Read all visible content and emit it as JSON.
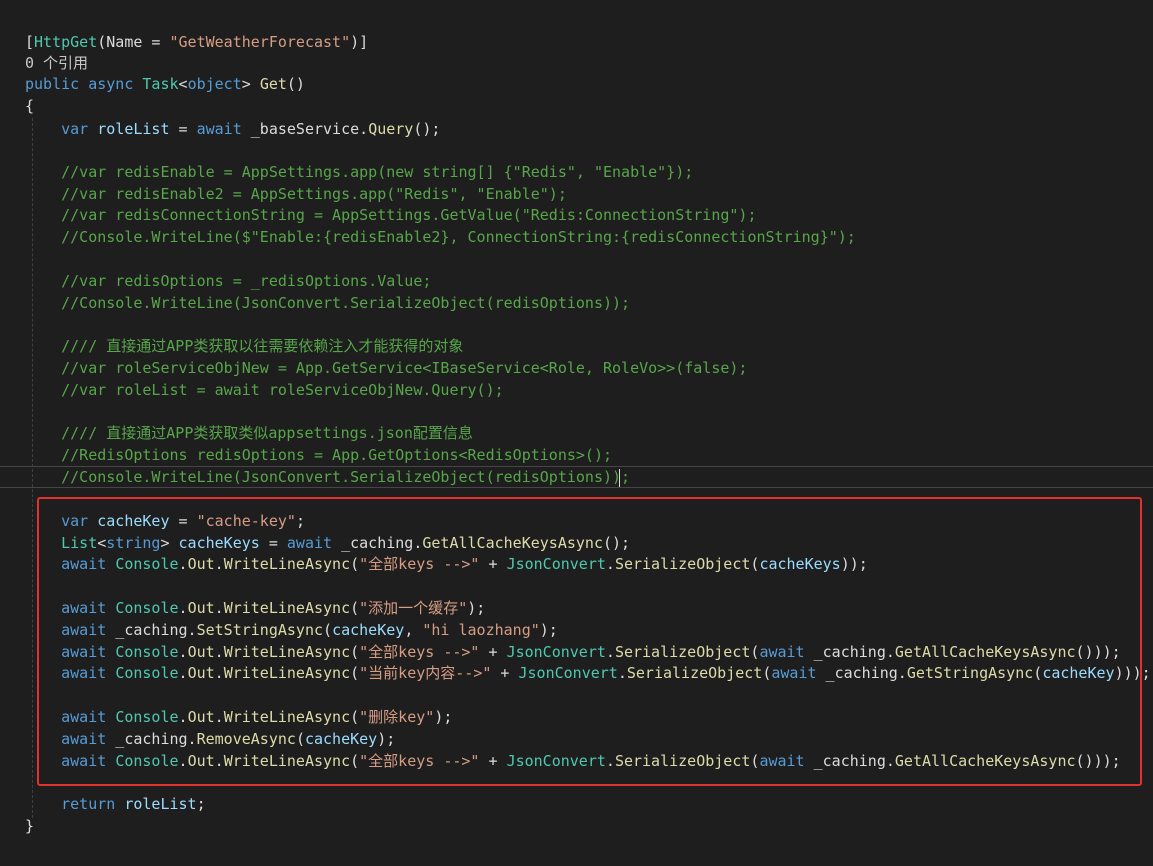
{
  "editor": {
    "colors": {
      "background": "#1e1e1e",
      "keyword": "#569cd6",
      "type": "#4ec9b0",
      "method": "#dcdcaa",
      "string": "#d69d85",
      "comment": "#57a64a",
      "variable": "#9cdcfe",
      "highlight_border": "#e0332e"
    },
    "lines": [
      {
        "tokens": [
          {
            "t": "p",
            "v": "["
          },
          {
            "t": "t",
            "v": "HttpGet"
          },
          {
            "t": "p",
            "v": "(Name = "
          },
          {
            "t": "s",
            "v": "\"GetWeatherForecast\""
          },
          {
            "t": "p",
            "v": ")]"
          }
        ]
      },
      {
        "tokens": [
          {
            "t": "g",
            "v": "0 个引用"
          }
        ]
      },
      {
        "tokens": [
          {
            "t": "k",
            "v": "public"
          },
          {
            "t": "p",
            "v": " "
          },
          {
            "t": "k",
            "v": "async"
          },
          {
            "t": "p",
            "v": " "
          },
          {
            "t": "t",
            "v": "Task"
          },
          {
            "t": "p",
            "v": "<"
          },
          {
            "t": "k",
            "v": "object"
          },
          {
            "t": "p",
            "v": "> "
          },
          {
            "t": "m",
            "v": "Get"
          },
          {
            "t": "p",
            "v": "()"
          }
        ]
      },
      {
        "tokens": [
          {
            "t": "p",
            "v": "{"
          }
        ]
      },
      {
        "tokens": [
          {
            "t": "p",
            "v": "    "
          },
          {
            "t": "k",
            "v": "var"
          },
          {
            "t": "p",
            "v": " "
          },
          {
            "t": "v",
            "v": "roleList"
          },
          {
            "t": "p",
            "v": " = "
          },
          {
            "t": "k",
            "v": "await"
          },
          {
            "t": "p",
            "v": " _baseService."
          },
          {
            "t": "m",
            "v": "Query"
          },
          {
            "t": "p",
            "v": "();"
          }
        ]
      },
      {
        "tokens": []
      },
      {
        "tokens": [
          {
            "t": "p",
            "v": "    "
          },
          {
            "t": "c",
            "v": "//var redisEnable = AppSettings.app(new string[] {\"Redis\", \"Enable\"});"
          }
        ]
      },
      {
        "tokens": [
          {
            "t": "p",
            "v": "    "
          },
          {
            "t": "c",
            "v": "//var redisEnable2 = AppSettings.app(\"Redis\", \"Enable\");"
          }
        ]
      },
      {
        "tokens": [
          {
            "t": "p",
            "v": "    "
          },
          {
            "t": "c",
            "v": "//var redisConnectionString = AppSettings.GetValue(\"Redis:ConnectionString\");"
          }
        ]
      },
      {
        "tokens": [
          {
            "t": "p",
            "v": "    "
          },
          {
            "t": "c",
            "v": "//Console.WriteLine($\"Enable:{redisEnable2}, ConnectionString:{redisConnectionString}\");"
          }
        ]
      },
      {
        "tokens": []
      },
      {
        "tokens": [
          {
            "t": "p",
            "v": "    "
          },
          {
            "t": "c",
            "v": "//var redisOptions = _redisOptions.Value;"
          }
        ]
      },
      {
        "tokens": [
          {
            "t": "p",
            "v": "    "
          },
          {
            "t": "c",
            "v": "//Console.WriteLine(JsonConvert.SerializeObject(redisOptions));"
          }
        ]
      },
      {
        "tokens": []
      },
      {
        "tokens": [
          {
            "t": "p",
            "v": "    "
          },
          {
            "t": "c",
            "v": "//// 直接通过APP类获取以往需要依赖注入才能获得的对象"
          }
        ]
      },
      {
        "tokens": [
          {
            "t": "p",
            "v": "    "
          },
          {
            "t": "c",
            "v": "//var roleServiceObjNew = App.GetService<IBaseService<Role, RoleVo>>(false);"
          }
        ]
      },
      {
        "tokens": [
          {
            "t": "p",
            "v": "    "
          },
          {
            "t": "c",
            "v": "//var roleList = await roleServiceObjNew.Query();"
          }
        ]
      },
      {
        "tokens": []
      },
      {
        "tokens": [
          {
            "t": "p",
            "v": "    "
          },
          {
            "t": "c",
            "v": "//// 直接通过APP类获取类似appsettings.json配置信息"
          }
        ]
      },
      {
        "tokens": [
          {
            "t": "p",
            "v": "    "
          },
          {
            "t": "c",
            "v": "//RedisOptions redisOptions = App.GetOptions<RedisOptions>();"
          }
        ]
      },
      {
        "tokens": [
          {
            "t": "p",
            "v": "    "
          },
          {
            "t": "c",
            "v": "//Console.WriteLine(JsonConvert.SerializeObject(redisOptions));"
          }
        ]
      },
      {
        "tokens": []
      },
      {
        "tokens": [
          {
            "t": "p",
            "v": "    "
          },
          {
            "t": "k",
            "v": "var"
          },
          {
            "t": "p",
            "v": " "
          },
          {
            "t": "v",
            "v": "cacheKey"
          },
          {
            "t": "p",
            "v": " = "
          },
          {
            "t": "s",
            "v": "\"cache-key\""
          },
          {
            "t": "p",
            "v": ";"
          }
        ]
      },
      {
        "tokens": [
          {
            "t": "p",
            "v": "    "
          },
          {
            "t": "t",
            "v": "List"
          },
          {
            "t": "p",
            "v": "<"
          },
          {
            "t": "k",
            "v": "string"
          },
          {
            "t": "p",
            "v": "> "
          },
          {
            "t": "v",
            "v": "cacheKeys"
          },
          {
            "t": "p",
            "v": " = "
          },
          {
            "t": "k",
            "v": "await"
          },
          {
            "t": "p",
            "v": " _caching."
          },
          {
            "t": "m",
            "v": "GetAllCacheKeysAsync"
          },
          {
            "t": "p",
            "v": "();"
          }
        ]
      },
      {
        "tokens": [
          {
            "t": "p",
            "v": "    "
          },
          {
            "t": "k",
            "v": "await"
          },
          {
            "t": "p",
            "v": " "
          },
          {
            "t": "t",
            "v": "Console"
          },
          {
            "t": "p",
            "v": "."
          },
          {
            "t": "m",
            "v": "Out"
          },
          {
            "t": "p",
            "v": "."
          },
          {
            "t": "m",
            "v": "WriteLineAsync"
          },
          {
            "t": "p",
            "v": "("
          },
          {
            "t": "s",
            "v": "\"全部keys -->\""
          },
          {
            "t": "p",
            "v": " + "
          },
          {
            "t": "t",
            "v": "JsonConvert"
          },
          {
            "t": "p",
            "v": "."
          },
          {
            "t": "m",
            "v": "SerializeObject"
          },
          {
            "t": "p",
            "v": "("
          },
          {
            "t": "v",
            "v": "cacheKeys"
          },
          {
            "t": "p",
            "v": "));"
          }
        ]
      },
      {
        "tokens": []
      },
      {
        "tokens": [
          {
            "t": "p",
            "v": "    "
          },
          {
            "t": "k",
            "v": "await"
          },
          {
            "t": "p",
            "v": " "
          },
          {
            "t": "t",
            "v": "Console"
          },
          {
            "t": "p",
            "v": "."
          },
          {
            "t": "m",
            "v": "Out"
          },
          {
            "t": "p",
            "v": "."
          },
          {
            "t": "m",
            "v": "WriteLineAsync"
          },
          {
            "t": "p",
            "v": "("
          },
          {
            "t": "s",
            "v": "\"添加一个缓存\""
          },
          {
            "t": "p",
            "v": ");"
          }
        ]
      },
      {
        "tokens": [
          {
            "t": "p",
            "v": "    "
          },
          {
            "t": "k",
            "v": "await"
          },
          {
            "t": "p",
            "v": " _caching."
          },
          {
            "t": "m",
            "v": "SetStringAsync"
          },
          {
            "t": "p",
            "v": "("
          },
          {
            "t": "v",
            "v": "cacheKey"
          },
          {
            "t": "p",
            "v": ", "
          },
          {
            "t": "s",
            "v": "\"hi laozhang\""
          },
          {
            "t": "p",
            "v": ");"
          }
        ]
      },
      {
        "tokens": [
          {
            "t": "p",
            "v": "    "
          },
          {
            "t": "k",
            "v": "await"
          },
          {
            "t": "p",
            "v": " "
          },
          {
            "t": "t",
            "v": "Console"
          },
          {
            "t": "p",
            "v": "."
          },
          {
            "t": "m",
            "v": "Out"
          },
          {
            "t": "p",
            "v": "."
          },
          {
            "t": "m",
            "v": "WriteLineAsync"
          },
          {
            "t": "p",
            "v": "("
          },
          {
            "t": "s",
            "v": "\"全部keys -->\""
          },
          {
            "t": "p",
            "v": " + "
          },
          {
            "t": "t",
            "v": "JsonConvert"
          },
          {
            "t": "p",
            "v": "."
          },
          {
            "t": "m",
            "v": "SerializeObject"
          },
          {
            "t": "p",
            "v": "("
          },
          {
            "t": "k",
            "v": "await"
          },
          {
            "t": "p",
            "v": " _caching."
          },
          {
            "t": "m",
            "v": "GetAllCacheKeysAsync"
          },
          {
            "t": "p",
            "v": "()));"
          }
        ]
      },
      {
        "tokens": [
          {
            "t": "p",
            "v": "    "
          },
          {
            "t": "k",
            "v": "await"
          },
          {
            "t": "p",
            "v": " "
          },
          {
            "t": "t",
            "v": "Console"
          },
          {
            "t": "p",
            "v": "."
          },
          {
            "t": "m",
            "v": "Out"
          },
          {
            "t": "p",
            "v": "."
          },
          {
            "t": "m",
            "v": "WriteLineAsync"
          },
          {
            "t": "p",
            "v": "("
          },
          {
            "t": "s",
            "v": "\"当前key内容-->\""
          },
          {
            "t": "p",
            "v": " + "
          },
          {
            "t": "t",
            "v": "JsonConvert"
          },
          {
            "t": "p",
            "v": "."
          },
          {
            "t": "m",
            "v": "SerializeObject"
          },
          {
            "t": "p",
            "v": "("
          },
          {
            "t": "k",
            "v": "await"
          },
          {
            "t": "p",
            "v": " _caching."
          },
          {
            "t": "m",
            "v": "GetStringAsync"
          },
          {
            "t": "p",
            "v": "("
          },
          {
            "t": "v",
            "v": "cacheKey"
          },
          {
            "t": "p",
            "v": ")));"
          }
        ]
      },
      {
        "tokens": []
      },
      {
        "tokens": [
          {
            "t": "p",
            "v": "    "
          },
          {
            "t": "k",
            "v": "await"
          },
          {
            "t": "p",
            "v": " "
          },
          {
            "t": "t",
            "v": "Console"
          },
          {
            "t": "p",
            "v": "."
          },
          {
            "t": "m",
            "v": "Out"
          },
          {
            "t": "p",
            "v": "."
          },
          {
            "t": "m",
            "v": "WriteLineAsync"
          },
          {
            "t": "p",
            "v": "("
          },
          {
            "t": "s",
            "v": "\"删除key\""
          },
          {
            "t": "p",
            "v": ");"
          }
        ]
      },
      {
        "tokens": [
          {
            "t": "p",
            "v": "    "
          },
          {
            "t": "k",
            "v": "await"
          },
          {
            "t": "p",
            "v": " _caching."
          },
          {
            "t": "m",
            "v": "RemoveAsync"
          },
          {
            "t": "p",
            "v": "("
          },
          {
            "t": "v",
            "v": "cacheKey"
          },
          {
            "t": "p",
            "v": ");"
          }
        ]
      },
      {
        "tokens": [
          {
            "t": "p",
            "v": "    "
          },
          {
            "t": "k",
            "v": "await"
          },
          {
            "t": "p",
            "v": " "
          },
          {
            "t": "t",
            "v": "Console"
          },
          {
            "t": "p",
            "v": "."
          },
          {
            "t": "m",
            "v": "Out"
          },
          {
            "t": "p",
            "v": "."
          },
          {
            "t": "m",
            "v": "WriteLineAsync"
          },
          {
            "t": "p",
            "v": "("
          },
          {
            "t": "s",
            "v": "\"全部keys -->\""
          },
          {
            "t": "p",
            "v": " + "
          },
          {
            "t": "t",
            "v": "JsonConvert"
          },
          {
            "t": "p",
            "v": "."
          },
          {
            "t": "m",
            "v": "SerializeObject"
          },
          {
            "t": "p",
            "v": "("
          },
          {
            "t": "k",
            "v": "await"
          },
          {
            "t": "p",
            "v": " _caching."
          },
          {
            "t": "m",
            "v": "GetAllCacheKeysAsync"
          },
          {
            "t": "p",
            "v": "()));"
          }
        ]
      },
      {
        "tokens": []
      },
      {
        "tokens": [
          {
            "t": "p",
            "v": "    "
          },
          {
            "t": "k",
            "v": "return"
          },
          {
            "t": "p",
            "v": " "
          },
          {
            "t": "v",
            "v": "roleList"
          },
          {
            "t": "p",
            "v": ";"
          }
        ]
      },
      {
        "tokens": [
          {
            "t": "p",
            "v": "}"
          }
        ]
      }
    ]
  }
}
